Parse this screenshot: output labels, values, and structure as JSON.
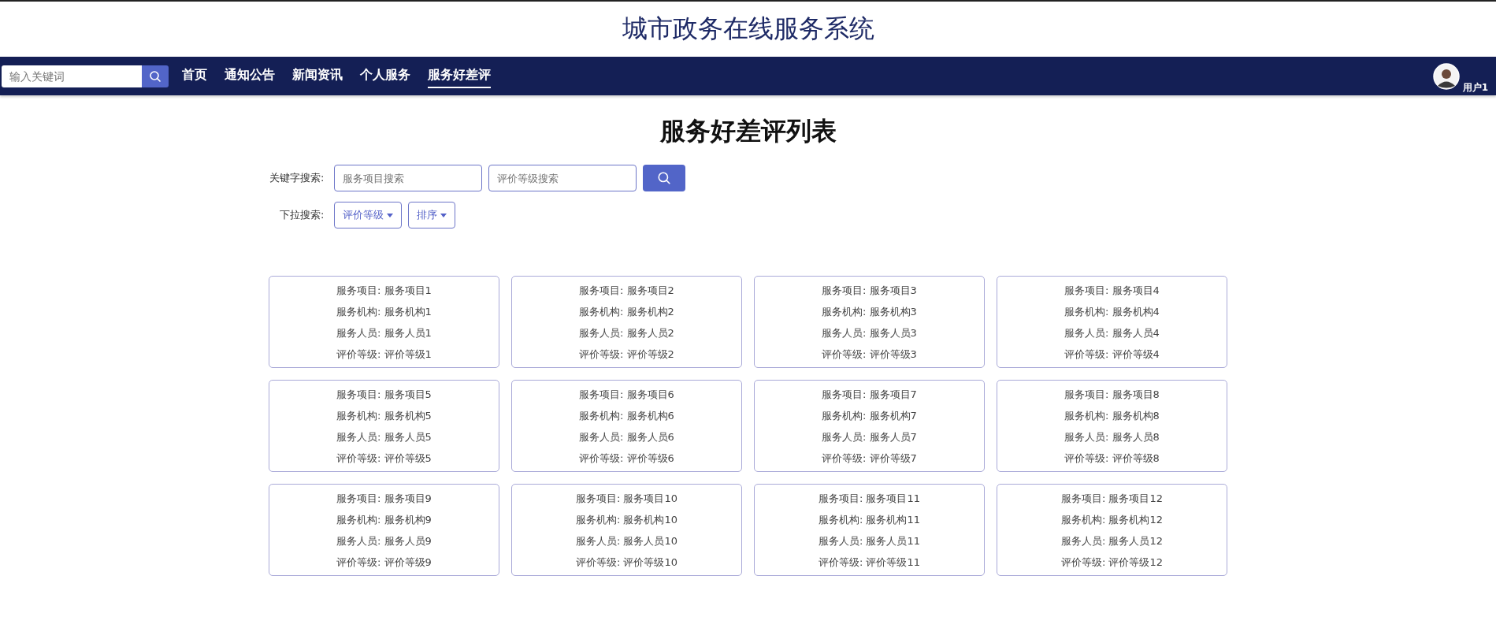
{
  "site_title": "城市政务在线服务系统",
  "nav": {
    "search": {
      "placeholder": "输入关键词"
    },
    "items": [
      {
        "label": "首页",
        "selected": false
      },
      {
        "label": "通知公告",
        "selected": false
      },
      {
        "label": "新闻资讯",
        "selected": false
      },
      {
        "label": "个人服务",
        "selected": false
      },
      {
        "label": "服务好差评",
        "selected": true
      }
    ],
    "user": "用户1"
  },
  "page_title": "服务好差评列表",
  "filters": {
    "keyword_label": "关键字搜索:",
    "fields": [
      {
        "placeholder": "服务项目搜索"
      },
      {
        "placeholder": "评价等级搜索"
      }
    ],
    "dropdown_label": "下拉搜索:",
    "dropdowns": [
      "评价等级",
      "排序"
    ]
  },
  "cards": [
    {
      "lines": [
        "服务项目: 服务项目1",
        "服务机构: 服务机构1",
        "服务人员: 服务人员1",
        "评价等级: 评价等级1"
      ]
    },
    {
      "lines": [
        "服务项目: 服务项目2",
        "服务机构: 服务机构2",
        "服务人员: 服务人员2",
        "评价等级: 评价等级2"
      ]
    },
    {
      "lines": [
        "服务项目: 服务项目3",
        "服务机构: 服务机构3",
        "服务人员: 服务人员3",
        "评价等级: 评价等级3"
      ]
    },
    {
      "lines": [
        "服务项目: 服务项目4",
        "服务机构: 服务机构4",
        "服务人员: 服务人员4",
        "评价等级: 评价等级4"
      ]
    },
    {
      "lines": [
        "服务项目: 服务项目5",
        "服务机构: 服务机构5",
        "服务人员: 服务人员5",
        "评价等级: 评价等级5"
      ]
    },
    {
      "lines": [
        "服务项目: 服务项目6",
        "服务机构: 服务机构6",
        "服务人员: 服务人员6",
        "评价等级: 评价等级6"
      ]
    },
    {
      "lines": [
        "服务项目: 服务项目7",
        "服务机构: 服务机构7",
        "服务人员: 服务人员7",
        "评价等级: 评价等级7"
      ]
    },
    {
      "lines": [
        "服务项目: 服务项目8",
        "服务机构: 服务机构8",
        "服务人员: 服务人员8",
        "评价等级: 评价等级8"
      ]
    },
    {
      "lines": [
        "服务项目: 服务项目9",
        "服务机构: 服务机构9",
        "服务人员: 服务人员9",
        "评价等级: 评价等级9"
      ]
    },
    {
      "lines": [
        "服务项目: 服务项目10",
        "服务机构: 服务机构10",
        "服务人员: 服务人员10",
        "评价等级: 评价等级10"
      ]
    },
    {
      "lines": [
        "服务项目: 服务项目11",
        "服务机构: 服务机构11",
        "服务人员: 服务人员11",
        "评价等级: 评价等级11"
      ]
    },
    {
      "lines": [
        "服务项目: 服务项目12",
        "服务机构: 服务机构12",
        "服务人员: 服务人员12",
        "评价等级: 评价等级12"
      ]
    }
  ]
}
